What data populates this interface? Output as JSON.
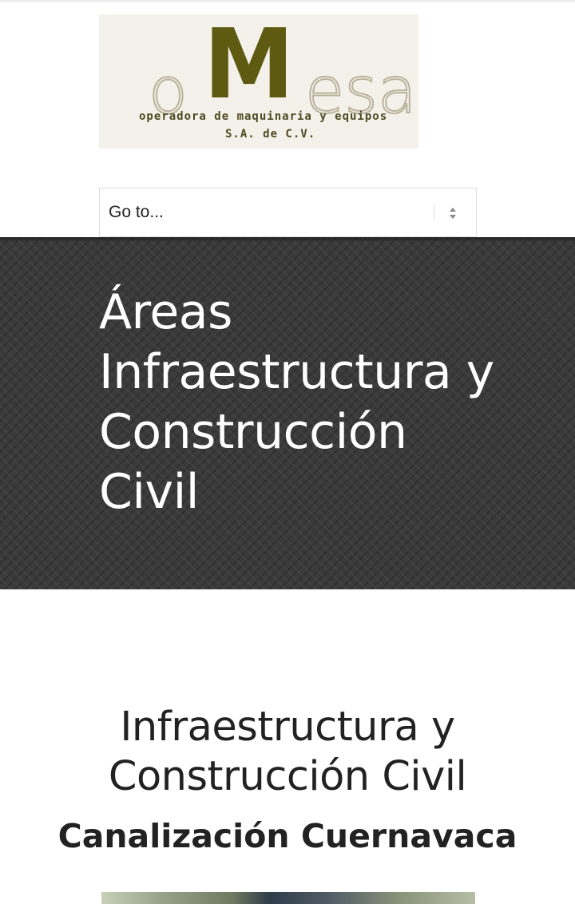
{
  "logo": {
    "letter_o": "o",
    "letter_m": "M",
    "letters_esa": "esa",
    "tagline_1": "operadora de maquinaria y equipos",
    "tagline_2": "S.A. de C.V.",
    "colors": {
      "brand": "#5e5a12",
      "outline": "#b9b39b"
    }
  },
  "nav": {
    "select_value": "Go to...",
    "icon": "select-arrows-icon"
  },
  "hero": {
    "title": "Áreas Infraestructura y Construcción Civil",
    "background": "#3a3a3a"
  },
  "content": {
    "title": "Infraestructura y Construcción Civil",
    "subtitle": "Canalización Cuernavaca"
  }
}
